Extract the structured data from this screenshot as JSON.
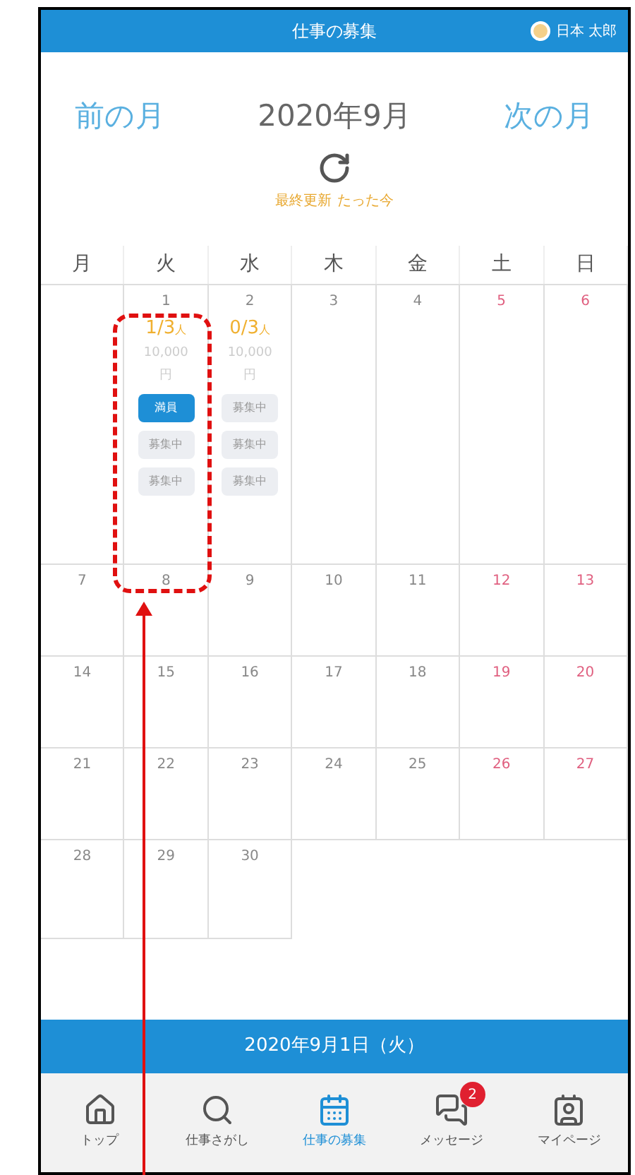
{
  "header": {
    "title": "仕事の募集",
    "user_name": "日本 太郎"
  },
  "month_nav": {
    "prev": "前の月",
    "current": "2020年9月",
    "next": "次の月"
  },
  "last_updated": {
    "label": "最終更新",
    "value": "たった今"
  },
  "weekdays": [
    {
      "label": "月",
      "weekend": false
    },
    {
      "label": "火",
      "weekend": false
    },
    {
      "label": "水",
      "weekend": false
    },
    {
      "label": "木",
      "weekend": false
    },
    {
      "label": "金",
      "weekend": false
    },
    {
      "label": "土",
      "weekend": false
    },
    {
      "label": "日",
      "weekend": false
    }
  ],
  "weeks": [
    [
      {
        "kind": "blank"
      },
      {
        "kind": "day",
        "day": "1",
        "weekend": false,
        "count": "1/3",
        "unit": "人",
        "fee": "10,000",
        "currency": "円",
        "slots": [
          {
            "label": "満員",
            "full": true
          },
          {
            "label": "募集中",
            "full": false
          },
          {
            "label": "募集中",
            "full": false
          }
        ]
      },
      {
        "kind": "day",
        "day": "2",
        "weekend": false,
        "count": "0/3",
        "unit": "人",
        "fee": "10,000",
        "currency": "円",
        "slots": [
          {
            "label": "募集中",
            "full": false
          },
          {
            "label": "募集中",
            "full": false
          },
          {
            "label": "募集中",
            "full": false
          }
        ]
      },
      {
        "kind": "day",
        "day": "3",
        "weekend": false
      },
      {
        "kind": "day",
        "day": "4",
        "weekend": false
      },
      {
        "kind": "day",
        "day": "5",
        "weekend": true
      },
      {
        "kind": "day",
        "day": "6",
        "weekend": true
      }
    ],
    [
      {
        "kind": "day",
        "day": "7",
        "weekend": false
      },
      {
        "kind": "day",
        "day": "8",
        "weekend": false
      },
      {
        "kind": "day",
        "day": "9",
        "weekend": false
      },
      {
        "kind": "day",
        "day": "10",
        "weekend": false
      },
      {
        "kind": "day",
        "day": "11",
        "weekend": false
      },
      {
        "kind": "day",
        "day": "12",
        "weekend": true
      },
      {
        "kind": "day",
        "day": "13",
        "weekend": true
      }
    ],
    [
      {
        "kind": "day",
        "day": "14",
        "weekend": false
      },
      {
        "kind": "day",
        "day": "15",
        "weekend": false
      },
      {
        "kind": "day",
        "day": "16",
        "weekend": false
      },
      {
        "kind": "day",
        "day": "17",
        "weekend": false
      },
      {
        "kind": "day",
        "day": "18",
        "weekend": false
      },
      {
        "kind": "day",
        "day": "19",
        "weekend": true
      },
      {
        "kind": "day",
        "day": "20",
        "weekend": true
      }
    ],
    [
      {
        "kind": "day",
        "day": "21",
        "weekend": false
      },
      {
        "kind": "day",
        "day": "22",
        "weekend": false
      },
      {
        "kind": "day",
        "day": "23",
        "weekend": false
      },
      {
        "kind": "day",
        "day": "24",
        "weekend": false
      },
      {
        "kind": "day",
        "day": "25",
        "weekend": false
      },
      {
        "kind": "day",
        "day": "26",
        "weekend": true
      },
      {
        "kind": "day",
        "day": "27",
        "weekend": true
      }
    ],
    [
      {
        "kind": "day",
        "day": "28",
        "weekend": false
      },
      {
        "kind": "day",
        "day": "29",
        "weekend": false
      },
      {
        "kind": "day",
        "day": "30",
        "weekend": false
      },
      {
        "kind": "blank"
      },
      {
        "kind": "blank"
      },
      {
        "kind": "blank"
      },
      {
        "kind": "blank"
      }
    ]
  ],
  "selected_date": "2020年9月1日（火）",
  "bottom_nav": [
    {
      "label": "トップ",
      "selected": false
    },
    {
      "label": "仕事さがし",
      "selected": false
    },
    {
      "label": "仕事の募集",
      "selected": true
    },
    {
      "label": "メッセージ",
      "selected": false,
      "badge": "2"
    },
    {
      "label": "マイページ",
      "selected": false
    }
  ]
}
